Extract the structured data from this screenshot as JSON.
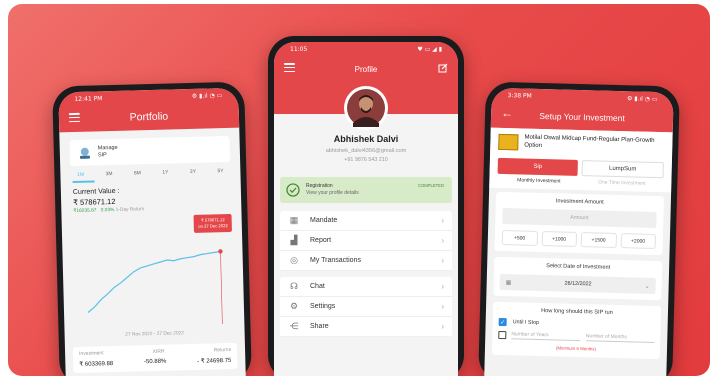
{
  "portfolio": {
    "status_time": "12:41 PM",
    "status_icons": "⚙ ▮.ıl ◔ ▭",
    "title": "Portfolio",
    "manage_label": "Manage",
    "manage_sub": "SIP",
    "tabs": [
      "1M",
      "3M",
      "6M",
      "1Y",
      "3Y",
      "5Y"
    ],
    "current_value_label": "Current Value :",
    "current_value": "₹ 578671.12",
    "day_gain": "₹16035.87",
    "day_pct": "0.03%",
    "day_label": "1-Day Return",
    "tooltip_value": "₹ 578671.12",
    "tooltip_date": "on 27 Dec 2022",
    "date_range": "27 Nov 2022 - 27 Dec 2022",
    "footer_headers": [
      "Investment",
      "XIRR",
      "Returns"
    ],
    "footer_values": [
      "₹ 603369.88",
      "-50.88%",
      "- ₹ 24698.75"
    ]
  },
  "profile": {
    "status_time": "11:05",
    "status_icons": "♥ ▭ ◢ ▮",
    "title": "Profile",
    "name": "Abhishek Dalvi",
    "email": "abhishek_dalvi4356@gmail.com",
    "phone": "+91 9876 543 210",
    "registration_title": "Registration",
    "registration_sub": "View your profile details",
    "registration_status": "COMPLETED",
    "menu_a": [
      "Mandate",
      "Report",
      "My Transactions"
    ],
    "menu_b": [
      "Chat",
      "Settings",
      "Share"
    ]
  },
  "invest": {
    "status_time": "3:38 PM",
    "status_icons": "⚙ ▮.ıl ◔ ▭",
    "title": "Setup Your Investment",
    "fund_name": "Motilal Oswal Midcap Fund-Regular Plan-Growth Option",
    "sip_label": "Sip",
    "lumpsum_label": "LumpSum",
    "monthly_label": "Monthly Investment",
    "onetime_label": "One Time Investment",
    "amount_title": "Investment Amount",
    "amount_placeholder": "Amount",
    "quick_amounts": [
      "+500",
      "+1000",
      "+1500",
      "+2000"
    ],
    "date_title": "Select Date of Investment",
    "date_value": "26/12/2022",
    "duration_title": "How long should this SIP run",
    "until_stop": "Until I Stop",
    "years_placeholder": "Number of Years",
    "months_placeholder": "Number of Months",
    "minimum_note": "(Minimum 6 Months)"
  },
  "colors": {
    "brand_red": "#e4474a",
    "chart_line": "#5bc0e8",
    "gain_green": "#2e9e4f"
  },
  "chart_data": {
    "type": "line",
    "title": "",
    "xlabel": "",
    "ylabel": "",
    "x": [
      0,
      1,
      2,
      3,
      4,
      5,
      6,
      7,
      8,
      9,
      10,
      11,
      12,
      13,
      14,
      15,
      16,
      17,
      18,
      19,
      20
    ],
    "values": [
      8,
      14,
      22,
      28,
      35,
      40,
      46,
      52,
      56,
      58,
      60,
      62,
      64,
      63,
      65,
      66,
      67,
      69,
      70,
      71,
      72
    ]
  }
}
